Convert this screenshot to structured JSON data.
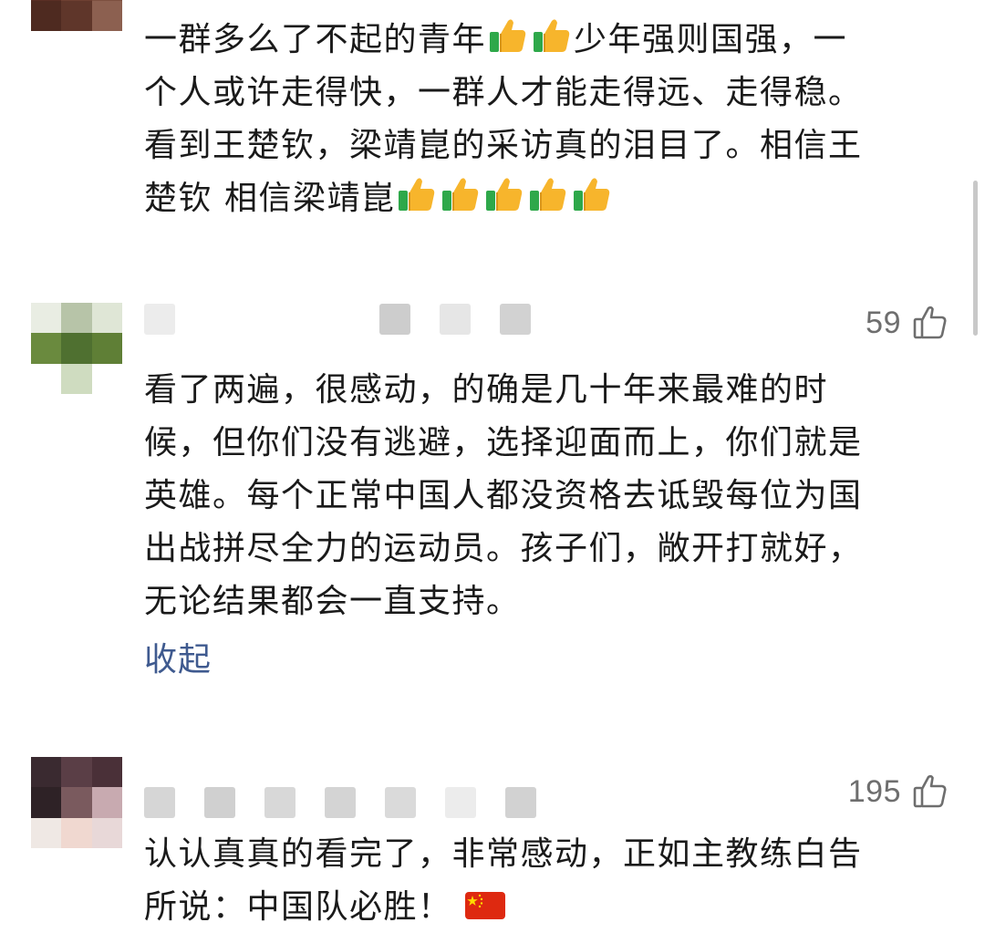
{
  "colors": {
    "link": "#3f5a8f",
    "like_count": "#6e6e6e",
    "thumb_gold": "#f7b52c",
    "thumb_cuff": "#2ea84a",
    "flag_red": "#de2910",
    "flag_star": "#ffde00"
  },
  "comments": [
    {
      "id": "comment-1",
      "avatar_icon": "blurred-avatar",
      "lines": [
        "一群多么了不起的青年",
        "少年强则国强，一",
        "个人或许走得快，一群人才能走得远、走得稳。",
        "看到王楚钦，梁靖崑的采访真的泪目了。相信王",
        "楚钦 相信梁靖崑"
      ],
      "inline_emoji": [
        "thumbs-up-emoji",
        "thumbs-up-emoji",
        "thumbs-up-emoji",
        "thumbs-up-emoji",
        "thumbs-up-emoji",
        "thumbs-up-emoji",
        "thumbs-up-emoji"
      ]
    },
    {
      "id": "comment-2",
      "avatar_icon": "blurred-avatar",
      "like_count": "59",
      "like_icon": "thumbs-up-outline-icon",
      "lines": [
        "看了两遍，很感动，的确是几十年来最难的时",
        "候，但你们没有逃避，选择迎面而上，你们就是",
        "英雄。每个正常中国人都没资格去诋毁每位为国",
        "出战拼尽全力的运动员。孩子们，敞开打就好，",
        "无论结果都会一直支持。"
      ],
      "collapse_label": "收起"
    },
    {
      "id": "comment-3",
      "avatar_icon": "blurred-avatar",
      "like_count": "195",
      "like_icon": "thumbs-up-outline-icon",
      "lines": [
        "认认真真的看完了，非常感动，正如主教练白告",
        "所说：中国队必胜！"
      ],
      "inline_emoji": [
        "china-flag-emoji"
      ]
    }
  ]
}
